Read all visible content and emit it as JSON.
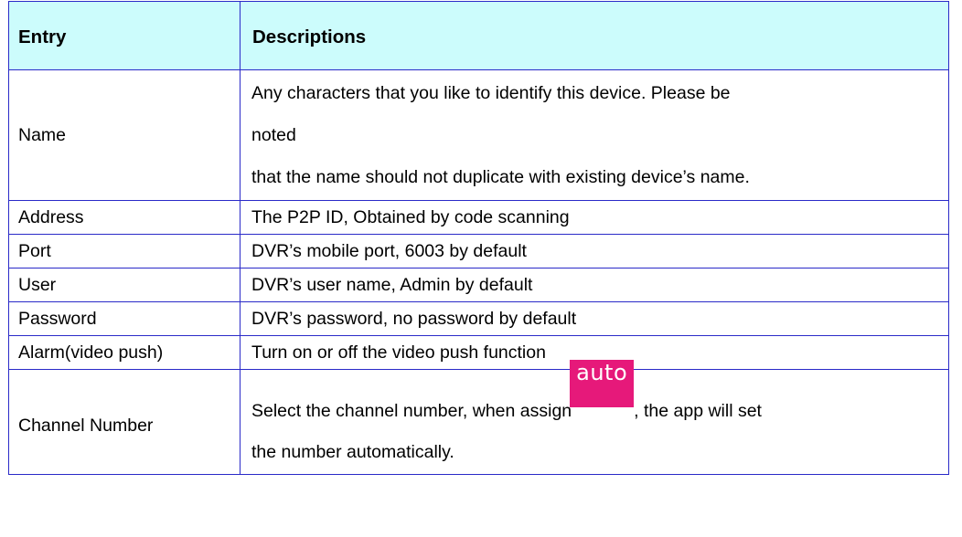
{
  "table": {
    "header": {
      "entry": "Entry",
      "descriptions": "Descriptions"
    },
    "rows": [
      {
        "entry": "Name",
        "lines": [
          "Any characters that you like to identify this device. Please be",
          "noted",
          "that the name should not duplicate with existing device’s name."
        ]
      },
      {
        "entry": "Address",
        "description": "The P2P ID, Obtained by code scanning"
      },
      {
        "entry": "Port",
        "description": "DVR’s mobile port, 6003 by default"
      },
      {
        "entry": "User",
        "description": "DVR’s user name, Admin by default"
      },
      {
        "entry": "Password",
        "description": "DVR’s password, no password by default"
      },
      {
        "entry": "Alarm(video push)",
        "description": "Turn on or off the video push function"
      },
      {
        "entry": "Channel Number",
        "line1_before": "Select the channel number, when assign",
        "badge": "auto",
        "line1_after": ", the app will set",
        "line2": "the number automatically."
      }
    ]
  },
  "colors": {
    "header_background": "#ccfcfc",
    "border": "#2a2ac8",
    "badge_background": "#e6197a",
    "badge_text": "#ffffff"
  }
}
